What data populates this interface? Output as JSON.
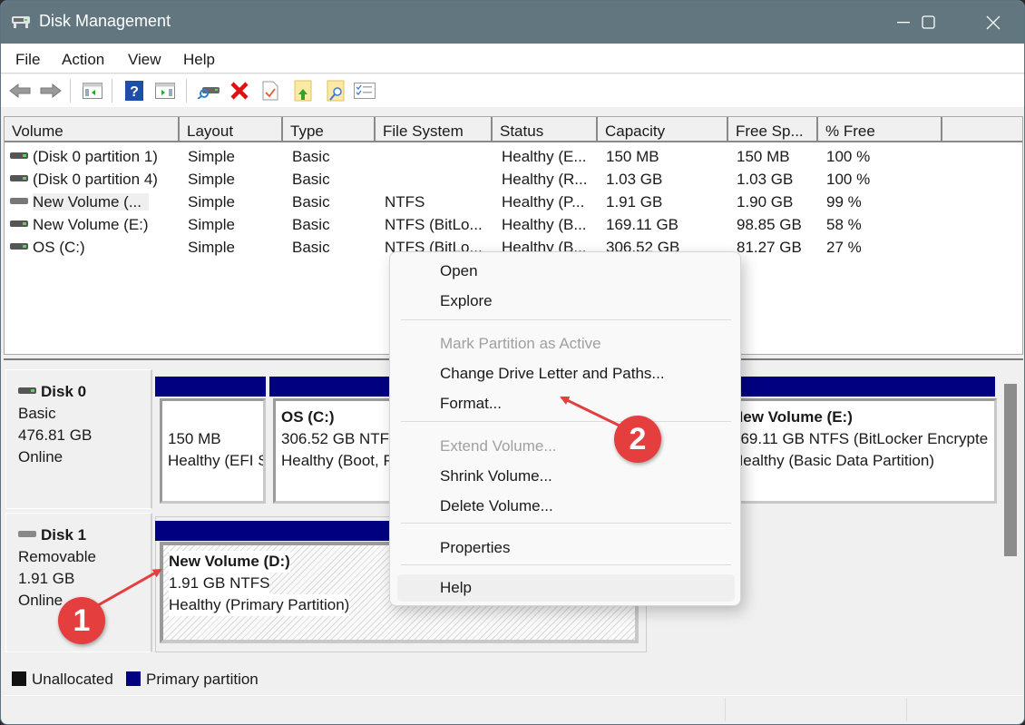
{
  "window": {
    "title": "Disk Management",
    "controls": {
      "minimize": "minimize",
      "maximize": "maximize",
      "close": "close"
    }
  },
  "menu": [
    "File",
    "Action",
    "View",
    "Help"
  ],
  "toolbar": {
    "icons": [
      "back-icon",
      "forward-icon",
      "show-hide-console-tree-icon",
      "help-icon",
      "show-hide-action-pane-icon",
      "connect-drive-icon",
      "delete-icon",
      "properties-check-icon",
      "open-folder-up-icon",
      "explore-folder-icon",
      "checklist-icon"
    ]
  },
  "volume_list": {
    "columns": [
      "Volume",
      "Layout",
      "Type",
      "File System",
      "Status",
      "Capacity",
      "Free Sp...",
      "% Free"
    ],
    "rows": [
      {
        "volume": "(Disk 0 partition 1)",
        "layout": "Simple",
        "type": "Basic",
        "fs": "",
        "status": "Healthy (E...",
        "capacity": "150 MB",
        "free": "150 MB",
        "pct": "100 %"
      },
      {
        "volume": "(Disk 0 partition 4)",
        "layout": "Simple",
        "type": "Basic",
        "fs": "",
        "status": "Healthy (R...",
        "capacity": "1.03 GB",
        "free": "1.03 GB",
        "pct": "100 %"
      },
      {
        "volume": "New Volume (...",
        "layout": "Simple",
        "type": "Basic",
        "fs": "NTFS",
        "status": "Healthy (P...",
        "capacity": "1.91 GB",
        "free": "1.90 GB",
        "pct": "99 %"
      },
      {
        "volume": "New Volume (E:)",
        "layout": "Simple",
        "type": "Basic",
        "fs": "NTFS (BitLo...",
        "status": "Healthy (B...",
        "capacity": "169.11 GB",
        "free": "98.85 GB",
        "pct": "58 %"
      },
      {
        "volume": "OS (C:)",
        "layout": "Simple",
        "type": "Basic",
        "fs": "NTFS (BitLo...",
        "status": "Healthy (B...",
        "capacity": "306.52 GB",
        "free": "81.27 GB",
        "pct": "27 %"
      }
    ]
  },
  "disks": [
    {
      "name": "Disk 0",
      "kind": "Basic",
      "size": "476.81 GB",
      "state": "Online",
      "partitions": [
        {
          "title": "",
          "line1": "150 MB",
          "line2": "Healthy (EFI S"
        },
        {
          "title": "OS  (C:)",
          "line1": "306.52 GB NTFS",
          "line2": "Healthy (Boot, P"
        },
        {
          "title": "New Volume  (E:)",
          "line1": "169.11 GB NTFS (BitLocker Encrypte",
          "line2": "Healthy (Basic Data Partition)"
        }
      ]
    },
    {
      "name": "Disk 1",
      "kind": "Removable",
      "size": "1.91 GB",
      "state": "Online",
      "partitions": [
        {
          "title": "New Volume  (D:)",
          "line1": "1.91 GB NTFS",
          "line2": "Healthy (Primary Partition)"
        }
      ]
    }
  ],
  "legend": [
    {
      "label": "Unallocated",
      "color": "#111111"
    },
    {
      "label": "Primary partition",
      "color": "#000080"
    }
  ],
  "context_menu": {
    "items": [
      {
        "label": "Open",
        "enabled": true
      },
      {
        "label": "Explore",
        "enabled": true
      },
      {
        "label": "Mark Partition as Active",
        "enabled": false
      },
      {
        "label": "Change Drive Letter and Paths...",
        "enabled": true
      },
      {
        "label": "Format...",
        "enabled": true
      },
      {
        "label": "Extend Volume...",
        "enabled": false
      },
      {
        "label": "Shrink Volume...",
        "enabled": true
      },
      {
        "label": "Delete Volume...",
        "enabled": true
      },
      {
        "label": "Properties",
        "enabled": true
      },
      {
        "label": "Help",
        "enabled": true,
        "highlighted": true
      }
    ]
  },
  "annotations": [
    {
      "number": "1",
      "color": "#e53e3e"
    },
    {
      "number": "2",
      "color": "#e53e3e"
    }
  ],
  "colors": {
    "titlebar": "#62767f",
    "partition_bar": "#000080",
    "annotation": "#e53e3e"
  }
}
